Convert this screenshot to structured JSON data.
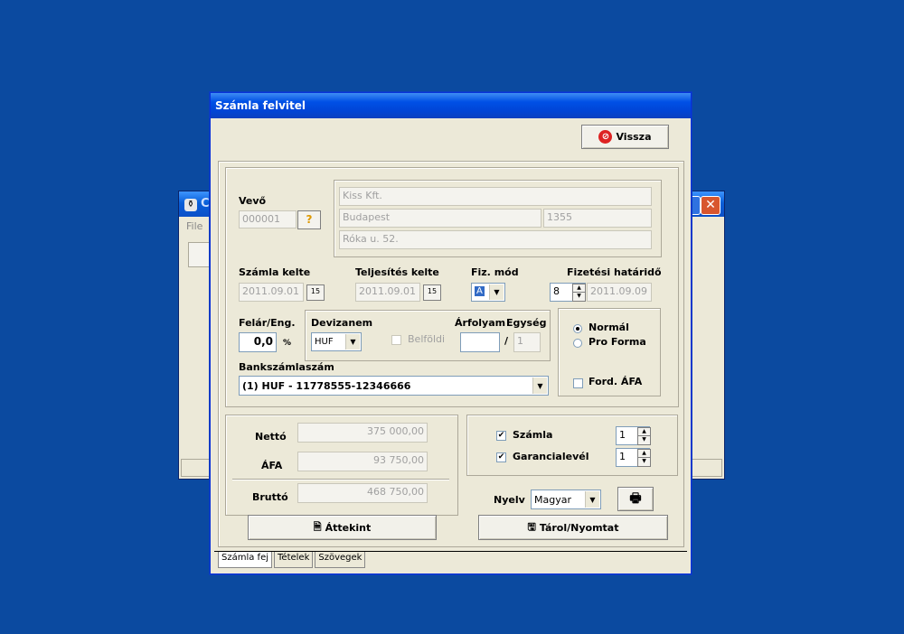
{
  "background_window": {
    "title": "C",
    "menu_file": "File",
    "close_glyph": "✕"
  },
  "dialog": {
    "title": "Számla felvitel",
    "back_button": "Vissza",
    "customer": {
      "label": "Vevő",
      "code": "000001",
      "lookup_glyph": "?",
      "name": "Kiss Kft.",
      "city": "Budapest",
      "zip": "1355",
      "street": "Róka u. 52."
    },
    "invoice_date": {
      "label": "Számla kelte",
      "value": "2011.09.01"
    },
    "fulfillment_date": {
      "label": "Teljesítés kelte",
      "value": "2011.09.01"
    },
    "payment_mode": {
      "label": "Fiz. mód",
      "value": "A"
    },
    "due_date": {
      "label": "Fizetési határidő",
      "days": "8",
      "value": "2011.09.09"
    },
    "surcharge": {
      "label": "Felár/Eng.",
      "value": "0,0",
      "unit": "%"
    },
    "currency": {
      "label": "Devizanem",
      "value": "HUF",
      "domestic_label": "Belföldi"
    },
    "rate": {
      "label": "Árfolyam",
      "value": "",
      "slash": "/",
      "unit_label": "Egység",
      "unit_value": "1"
    },
    "invoice_type": {
      "normal": "Normál",
      "proforma": "Pro Forma",
      "reverse_vat": "Ford. ÁFA"
    },
    "bank_account": {
      "label": "Bankszámlaszám",
      "value": "(1) HUF - 11778555-12346666"
    },
    "totals": {
      "net_label": "Nettó",
      "net": "375 000,00",
      "vat_label": "ÁFA",
      "vat": "93 750,00",
      "gross_label": "Bruttó",
      "gross": "468 750,00"
    },
    "print_options": {
      "invoice_label": "Számla",
      "invoice_copies": "1",
      "warranty_label": "Garancialevél",
      "warranty_copies": "1"
    },
    "language": {
      "label": "Nyelv",
      "value": "Magyar"
    },
    "overview_button": "Áttekint",
    "save_print_button": "Tárol/Nyomtat",
    "tabs": [
      "Számla fej",
      "Tételek",
      "Szövegek"
    ]
  },
  "colors": {
    "desktop": "#0b4aa0",
    "titlebar": "#0050e6",
    "face": "#ece9d8"
  }
}
